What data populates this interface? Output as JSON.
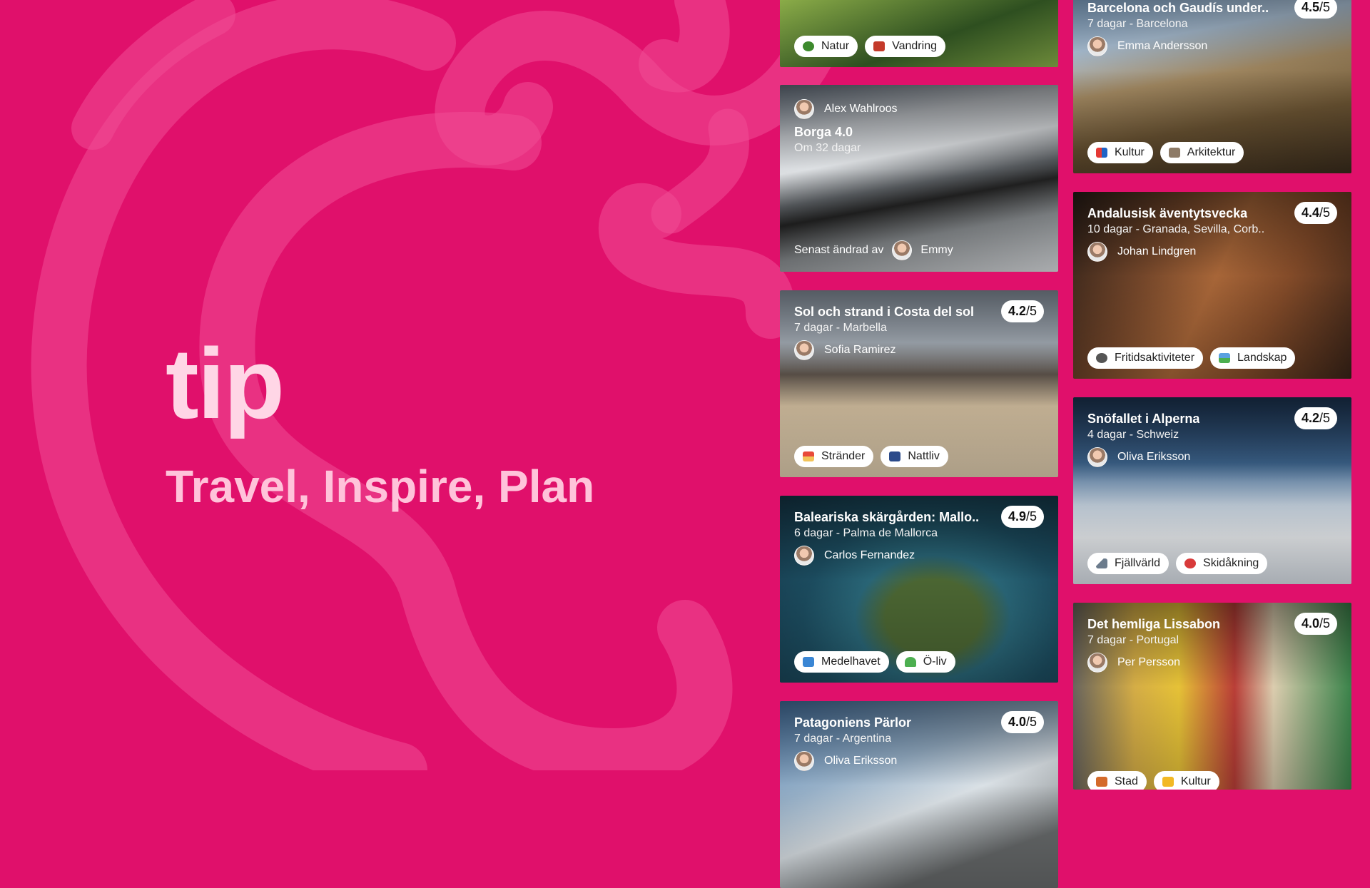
{
  "brand": {
    "logo_text": "tip",
    "tagline": "Travel, Inspire, Plan"
  },
  "cards": {
    "natur": {
      "tags": [
        {
          "label": "Natur",
          "icon": "tree-icon"
        },
        {
          "label": "Vandring",
          "icon": "backpack-icon"
        }
      ]
    },
    "borga": {
      "author": "Alex Wahlroos",
      "title": "Borga 4.0",
      "subtitle": "Om 32 dagar",
      "edited_label": "Senast ändrad av",
      "edited_by": "Emmy"
    },
    "costa": {
      "title": "Sol och strand i Costa del sol",
      "subtitle": "7 dagar - Marbella",
      "author": "Sofia Ramirez",
      "rating": "4.2",
      "rating_max": "/5",
      "tags": [
        {
          "label": "Stränder",
          "icon": "beach-icon"
        },
        {
          "label": "Nattliv",
          "icon": "city-night-icon"
        }
      ]
    },
    "mallorca": {
      "title": "Baleariska skärgården: Mallo..",
      "subtitle": "6 dagar - Palma de Mallorca",
      "author": "Carlos Fernandez",
      "rating": "4.9",
      "rating_max": "/5",
      "tags": [
        {
          "label": "Medelhavet",
          "icon": "wave-icon"
        },
        {
          "label": "Ö-liv",
          "icon": "palm-tree-icon"
        }
      ]
    },
    "patagonien": {
      "title": "Patagoniens Pärlor",
      "subtitle": "7 dagar - Argentina",
      "author": "Oliva Eriksson",
      "rating": "4.0",
      "rating_max": "/5"
    },
    "barcelona": {
      "title": "Barcelona och Gaudís under..",
      "subtitle": "7 dagar - Barcelona",
      "author": "Emma Andersson",
      "rating": "4.5",
      "rating_max": "/5",
      "tags": [
        {
          "label": "Kultur",
          "icon": "theater-masks-icon"
        },
        {
          "label": "Arkitektur",
          "icon": "cathedral-icon"
        }
      ]
    },
    "andalusien": {
      "title": "Andalusisk äventytsvecka",
      "subtitle": "10 dagar - Granada, Sevilla, Corb..",
      "author": "Johan Lindgren",
      "rating": "4.4",
      "rating_max": "/5",
      "tags": [
        {
          "label": "Fritidsaktiviteter",
          "icon": "bicycle-icon"
        },
        {
          "label": "Landskap",
          "icon": "landscape-icon"
        }
      ]
    },
    "alperna": {
      "title": "Snöfallet i Alperna",
      "subtitle": "4 dagar - Schweiz",
      "author": "Oliva Eriksson",
      "rating": "4.2",
      "rating_max": "/5",
      "tags": [
        {
          "label": "Fjällvärld",
          "icon": "mountain-icon"
        },
        {
          "label": "Skidåkning",
          "icon": "skier-icon"
        }
      ]
    },
    "lissabon": {
      "title": "Det hemliga Lissabon",
      "subtitle": "7 dagar - Portugal",
      "author": "Per Persson",
      "rating": "4.0",
      "rating_max": "/5",
      "tags": [
        {
          "label": "Stad",
          "icon": "city-icon"
        },
        {
          "label": "Kultur",
          "icon": "theater-masks-icon"
        }
      ]
    }
  }
}
